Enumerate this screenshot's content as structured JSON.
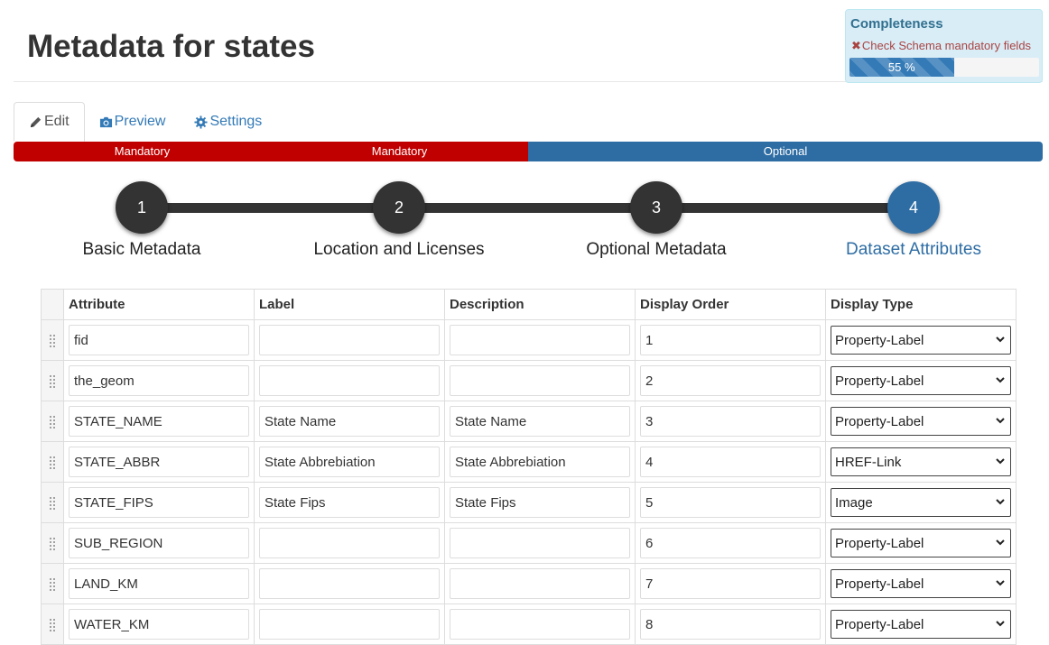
{
  "header": {
    "title": "Metadata for states"
  },
  "completeness": {
    "title": "Completeness",
    "message": "Check Schema mandatory fields",
    "percent_label": "55 %",
    "percent": 55,
    "message_icon": "x-icon"
  },
  "tabs": [
    {
      "label": "Edit",
      "icon": "pencil-icon",
      "active": true
    },
    {
      "label": "Preview",
      "icon": "camera-icon",
      "active": false
    },
    {
      "label": "Settings",
      "icon": "gear-icon",
      "active": false
    }
  ],
  "segments": [
    {
      "label": "Mandatory",
      "status": "mandatory",
      "color": "#c00000"
    },
    {
      "label": "Mandatory",
      "status": "mandatory",
      "color": "#c00000"
    },
    {
      "label": "Optional",
      "status": "optional",
      "color": "#2e6da4"
    }
  ],
  "wizard": {
    "current_step": 4,
    "steps": [
      {
        "number": "1",
        "label": "Basic Metadata"
      },
      {
        "number": "2",
        "label": "Location and Licenses"
      },
      {
        "number": "3",
        "label": "Optional Metadata"
      },
      {
        "number": "4",
        "label": "Dataset Attributes"
      }
    ]
  },
  "table": {
    "columns": [
      "Attribute",
      "Label",
      "Description",
      "Display Order",
      "Display Type"
    ],
    "rows": [
      {
        "attribute": "fid",
        "label": "",
        "description": "",
        "order": "1",
        "type": "Property-Label"
      },
      {
        "attribute": "the_geom",
        "label": "",
        "description": "",
        "order": "2",
        "type": "Property-Label"
      },
      {
        "attribute": "STATE_NAME",
        "label": "State Name",
        "description": "State Name",
        "order": "3",
        "type": "Property-Label"
      },
      {
        "attribute": "STATE_ABBR",
        "label": "State Abbrebiation",
        "description": "State Abbrebiation",
        "order": "4",
        "type": "HREF-Link"
      },
      {
        "attribute": "STATE_FIPS",
        "label": "State Fips",
        "description": "State Fips",
        "order": "5",
        "type": "Image"
      },
      {
        "attribute": "SUB_REGION",
        "label": "",
        "description": "",
        "order": "6",
        "type": "Property-Label"
      },
      {
        "attribute": "LAND_KM",
        "label": "",
        "description": "",
        "order": "7",
        "type": "Property-Label"
      },
      {
        "attribute": "WATER_KM",
        "label": "",
        "description": "",
        "order": "8",
        "type": "Property-Label"
      }
    ]
  },
  "colors": {
    "mandatory": "#c00000",
    "optional": "#2e6da4",
    "step_done": "#333333",
    "step_current": "#2e6da4",
    "link": "#337ab7"
  }
}
